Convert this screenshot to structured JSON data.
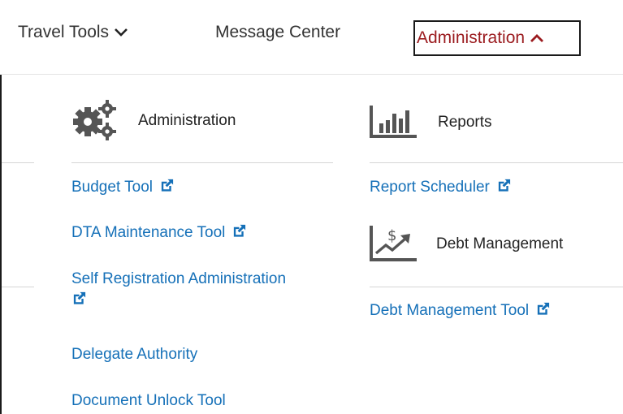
{
  "nav": {
    "travel_tools": "Travel Tools",
    "message_center": "Message Center",
    "administration": "Administration"
  },
  "admin_section": {
    "title": "Administration",
    "links": [
      "Budget Tool",
      "DTA Maintenance Tool",
      "Self Registration Administration",
      "Delegate Authority",
      "Document Unlock Tool"
    ]
  },
  "reports_section": {
    "title": "Reports",
    "links": [
      "Report Scheduler"
    ]
  },
  "debt_section": {
    "title": "Debt Management",
    "links": [
      "Debt Management Tool"
    ]
  },
  "colors": {
    "link": "#1570b8",
    "active_nav": "#9b1b1f",
    "icon_gray": "#555555"
  },
  "icons": [
    "chevron-down-icon",
    "chevron-up-icon",
    "gears-icon",
    "bar-chart-icon",
    "dollar-trend-icon",
    "external-link-icon"
  ]
}
